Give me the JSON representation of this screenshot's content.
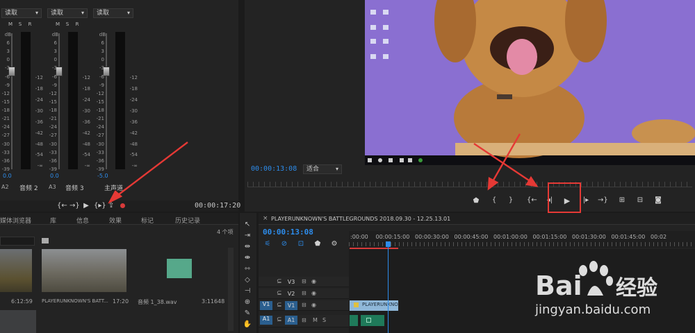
{
  "mixer": {
    "channels": [
      {
        "read": "读取",
        "label": "音频 2",
        "id": "A2",
        "db": ""
      },
      {
        "read": "读取",
        "label": "音频 3",
        "id": "A3",
        "db": ""
      },
      {
        "read": "读取",
        "label": "主声道",
        "id": "",
        "db": "-5.0"
      }
    ],
    "m": "M",
    "s": "S",
    "r": "R",
    "db_unit": "dB",
    "zero": "0.0",
    "scale_left": [
      "6",
      "3",
      "0",
      "-3",
      "-6",
      "-9",
      "-12",
      "-15",
      "-18",
      "-21",
      "-24",
      "-27",
      "-30",
      "-33",
      "-36",
      "-39"
    ],
    "scale_right": [
      "-12",
      "-18",
      "-24",
      "-30",
      "-36",
      "-42",
      "-48",
      "-54",
      "-∞"
    ],
    "timecode": "00:00:17:20"
  },
  "monitor": {
    "timecode": "00:00:13:08",
    "fit": "适合"
  },
  "project": {
    "tabs": [
      "媒体浏览器",
      "库",
      "信息",
      "效果",
      "标记",
      "历史记录"
    ],
    "count": "4 个项",
    "items": [
      {
        "name": "",
        "duration": "6:12:59"
      },
      {
        "name": "PLAYERUNKNOWN'S BATT...",
        "duration": "17:20"
      },
      {
        "name": "音频 1_38.wav",
        "duration": "3:11648"
      }
    ]
  },
  "timeline": {
    "tab": "PLAYERUNKNOWN'S BATTLEGROUNDS 2018.09.30 - 12.25.13.01",
    "close": "×",
    "timecode": "00:00:13:08",
    "ruler": [
      ":00:00",
      "00:00:15:00",
      "00:00:30:00",
      "00:00:45:00",
      "00:01:00:00",
      "00:01:15:00",
      "00:01:30:00",
      "00:01:45:00",
      "00:02"
    ],
    "tracks": [
      {
        "id": "V3",
        "src": ""
      },
      {
        "id": "V2",
        "src": ""
      },
      {
        "id": "V1",
        "src": "V1"
      },
      {
        "id": "A1",
        "src": "A1"
      }
    ],
    "clip_label": "PLAYERUNKNO",
    "m": "M",
    "s": "S"
  },
  "watermark": {
    "brand": "Bai",
    "brand2": "经验",
    "url": "jingyan.baidu.com"
  },
  "colors": {
    "accent": "#2d8ceb",
    "arrow": "#e53935",
    "clip_video": "#8fb8d9",
    "clip_audio": "#1f7a5a"
  }
}
